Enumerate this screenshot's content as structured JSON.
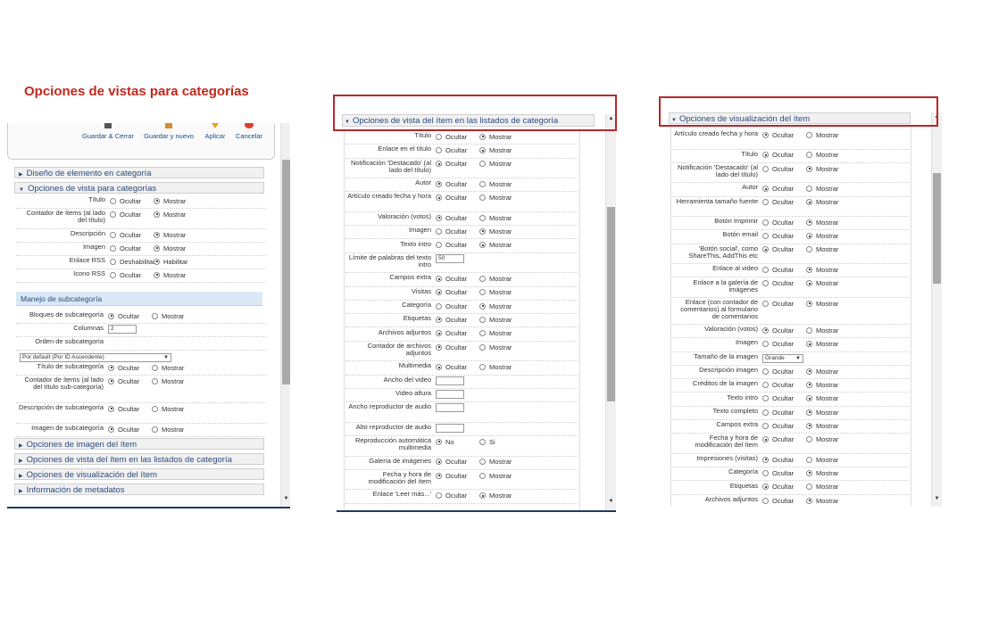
{
  "title": "Opciones de vistas para categorías",
  "colors": {
    "title": "#c0281c",
    "link": "#2c4a7c",
    "highlight_box": "#b8262a",
    "subheader_bg": "#dbe9f7"
  },
  "panel1": {
    "toolbar": [
      {
        "label": "Guardar & Cerrar",
        "icon": "save-close-icon"
      },
      {
        "label": "Guardar y nuevo",
        "icon": "save-new-icon"
      },
      {
        "label": "Aplicar",
        "icon": "apply-icon"
      },
      {
        "label": "Cancelar",
        "icon": "cancel-icon"
      }
    ],
    "sections_top": [
      {
        "label": "Diseño de elemento en categoría",
        "expanded": false
      },
      {
        "label": "Opciones de vista para categorías",
        "expanded": true
      }
    ],
    "rows_a": [
      {
        "label": "Título",
        "options": [
          "Ocultar",
          "Mostrar"
        ],
        "selected": 1
      },
      {
        "label": "Contador de ítems (al lado del título)",
        "options": [
          "Ocultar",
          "Mostrar"
        ],
        "selected": 1
      },
      {
        "label": "Descripción",
        "options": [
          "Ocultar",
          "Mostrar"
        ],
        "selected": 1
      },
      {
        "label": "Imagen",
        "options": [
          "Ocultar",
          "Mostrar"
        ],
        "selected": 1
      },
      {
        "label": "Enlace RSS",
        "options": [
          "Deshabilitar",
          "Habilitar"
        ],
        "selected": 1
      },
      {
        "label": "Icono RSS",
        "options": [
          "Ocultar",
          "Mostrar"
        ],
        "selected": 1
      }
    ],
    "subheader": "Manejo de subcategoría",
    "rows_b": [
      {
        "label": "Bloques de subcategoría",
        "options": [
          "Ocultar",
          "Mostrar"
        ],
        "selected": 0
      },
      {
        "label": "Columnas",
        "input": "2"
      },
      {
        "label": "Orden de subcategoría"
      }
    ],
    "order_select": "Por default (Por ID Ascendente)",
    "rows_c": [
      {
        "label": "Título de subcategoría",
        "options": [
          "Ocultar",
          "Mostrar"
        ],
        "selected": 0
      },
      {
        "label": "Contador de ítems (al lado del título sub-categoría)",
        "options": [
          "Ocultar",
          "Mostrar"
        ],
        "selected": 0
      },
      {
        "label": "Descripción de subcategoría",
        "options": [
          "Ocultar",
          "Mostrar"
        ],
        "selected": 0
      },
      {
        "label": "Imagen de subcategoría",
        "options": [
          "Ocultar",
          "Mostrar"
        ],
        "selected": 0
      }
    ],
    "sections_bottom": [
      {
        "label": "Opciones de imagen del ítem"
      },
      {
        "label": "Opciones de vista del ítem en las listados de categoría"
      },
      {
        "label": "Opciones de visualización del ítem"
      },
      {
        "label": "Información de metadatos"
      }
    ]
  },
  "panel2": {
    "header": "Opciones de vista del ítem en las listados de categoría",
    "rows": [
      {
        "label": "Título",
        "options": [
          "Ocultar",
          "Mostrar"
        ],
        "selected": 1
      },
      {
        "label": "Enlace en el título",
        "options": [
          "Ocultar",
          "Mostrar"
        ],
        "selected": 1
      },
      {
        "label": "Notificación 'Destacado' (al lado del título)",
        "options": [
          "Ocultar",
          "Mostrar"
        ],
        "selected": 0
      },
      {
        "label": "Autor",
        "options": [
          "Ocultar",
          "Mostrar"
        ],
        "selected": 0
      },
      {
        "label": "Artículo creado fecha y hora",
        "options": [
          "Ocultar",
          "Mostrar"
        ],
        "selected": 0
      },
      {
        "label": "Valoración (votos)",
        "options": [
          "Ocultar",
          "Mostrar"
        ],
        "selected": 0
      },
      {
        "label": "Imagen",
        "options": [
          "Ocultar",
          "Mostrar"
        ],
        "selected": 1
      },
      {
        "label": "Texto intro",
        "options": [
          "Ocultar",
          "Mostrar"
        ],
        "selected": 1
      },
      {
        "label": "Límite de palabras del texto intro",
        "input": "50"
      },
      {
        "label": "Campos extra",
        "options": [
          "Ocultar",
          "Mostrar"
        ],
        "selected": 0
      },
      {
        "label": "Visitas",
        "options": [
          "Ocultar",
          "Mostrar"
        ],
        "selected": 0
      },
      {
        "label": "Categoría",
        "options": [
          "Ocultar",
          "Mostrar"
        ],
        "selected": 1
      },
      {
        "label": "Etiquetas",
        "options": [
          "Ocultar",
          "Mostrar"
        ],
        "selected": 0
      },
      {
        "label": "Archivos adjuntos",
        "options": [
          "Ocultar",
          "Mostrar"
        ],
        "selected": 0
      },
      {
        "label": "Contador de archivos adjuntos",
        "options": [
          "Ocultar",
          "Mostrar"
        ],
        "selected": 0
      },
      {
        "label": "Multimedia",
        "options": [
          "Ocultar",
          "Mostrar"
        ],
        "selected": 0
      },
      {
        "label": "Ancho del video",
        "input": ""
      },
      {
        "label": "Video altura",
        "input": ""
      },
      {
        "label": "Ancho reproductor de audio",
        "input": ""
      },
      {
        "label": "Alto reproductor de audio",
        "input": ""
      },
      {
        "label": "Reproducción automática multimedia",
        "options": [
          "No",
          "Si"
        ],
        "selected": 0
      },
      {
        "label": "Galería de imágenes",
        "options": [
          "Ocultar",
          "Mostrar"
        ],
        "selected": 0
      },
      {
        "label": "Fecha y hora de modificación del ítem",
        "options": [
          "Ocultar",
          "Mostrar"
        ],
        "selected": 0
      },
      {
        "label": "Enlace 'Leer más...'",
        "options": [
          "Ocultar",
          "Mostrar"
        ],
        "selected": 1
      }
    ]
  },
  "panel3": {
    "header": "Opciones de visualización del ítem",
    "rows": [
      {
        "label": "Artículo creado fecha y hora",
        "options": [
          "Ocultar",
          "Mostrar"
        ],
        "selected": 0
      },
      {
        "label": "Título",
        "options": [
          "Ocultar",
          "Mostrar"
        ],
        "selected": 0
      },
      {
        "label": "Notificación 'Destacado' (al lado del título)",
        "options": [
          "Ocultar",
          "Mostrar"
        ],
        "selected": 1
      },
      {
        "label": "Autor",
        "options": [
          "Ocultar",
          "Mostrar"
        ],
        "selected": 0
      },
      {
        "label": "Herramienta tamaño fuente",
        "options": [
          "Ocultar",
          "Mostrar"
        ],
        "selected": 1
      },
      {
        "label": "Botón Imprimir",
        "options": [
          "Ocultar",
          "Mostrar"
        ],
        "selected": 1
      },
      {
        "label": "Botón email",
        "options": [
          "Ocultar",
          "Mostrar"
        ],
        "selected": 1
      },
      {
        "label": "'Botón social', como ShareThis, AddThis etc",
        "options": [
          "Ocultar",
          "Mostrar"
        ],
        "selected": 0
      },
      {
        "label": "Enlace al video",
        "options": [
          "Ocultar",
          "Mostrar"
        ],
        "selected": 1
      },
      {
        "label": "Enlace a la galería de imágenes",
        "options": [
          "Ocultar",
          "Mostrar"
        ],
        "selected": 1
      },
      {
        "label": "Enlace (con contador de comentarios) al formulario de comentarios",
        "options": [
          "Ocultar",
          "Mostrar"
        ],
        "selected": 1
      },
      {
        "label": "Valoración (votos)",
        "options": [
          "Ocultar",
          "Mostrar"
        ],
        "selected": 0
      },
      {
        "label": "Imagen",
        "options": [
          "Ocultar",
          "Mostrar"
        ],
        "selected": 1
      },
      {
        "label": "Tamaño de la imagen",
        "select": "Grande"
      },
      {
        "label": "Descripción imagen",
        "options": [
          "Ocultar",
          "Mostrar"
        ],
        "selected": 1
      },
      {
        "label": "Créditos de la imagen",
        "options": [
          "Ocultar",
          "Mostrar"
        ],
        "selected": 1
      },
      {
        "label": "Texto intro",
        "options": [
          "Ocultar",
          "Mostrar"
        ],
        "selected": 1
      },
      {
        "label": "Texto completo",
        "options": [
          "Ocultar",
          "Mostrar"
        ],
        "selected": 1
      },
      {
        "label": "Campos extra",
        "options": [
          "Ocultar",
          "Mostrar"
        ],
        "selected": 1
      },
      {
        "label": "Fecha y hora de modificación del ítem",
        "options": [
          "Ocultar",
          "Mostrar"
        ],
        "selected": 0
      },
      {
        "label": "Impresiones (visitas)",
        "options": [
          "Ocultar",
          "Mostrar"
        ],
        "selected": 0
      },
      {
        "label": "Categoría",
        "options": [
          "Ocultar",
          "Mostrar"
        ],
        "selected": 1
      },
      {
        "label": "Etiquetas",
        "options": [
          "Ocultar",
          "Mostrar"
        ],
        "selected": 0
      },
      {
        "label": "Archivos adjuntos",
        "options": [
          "Ocultar",
          "Mostrar"
        ],
        "selected": 1
      }
    ]
  }
}
